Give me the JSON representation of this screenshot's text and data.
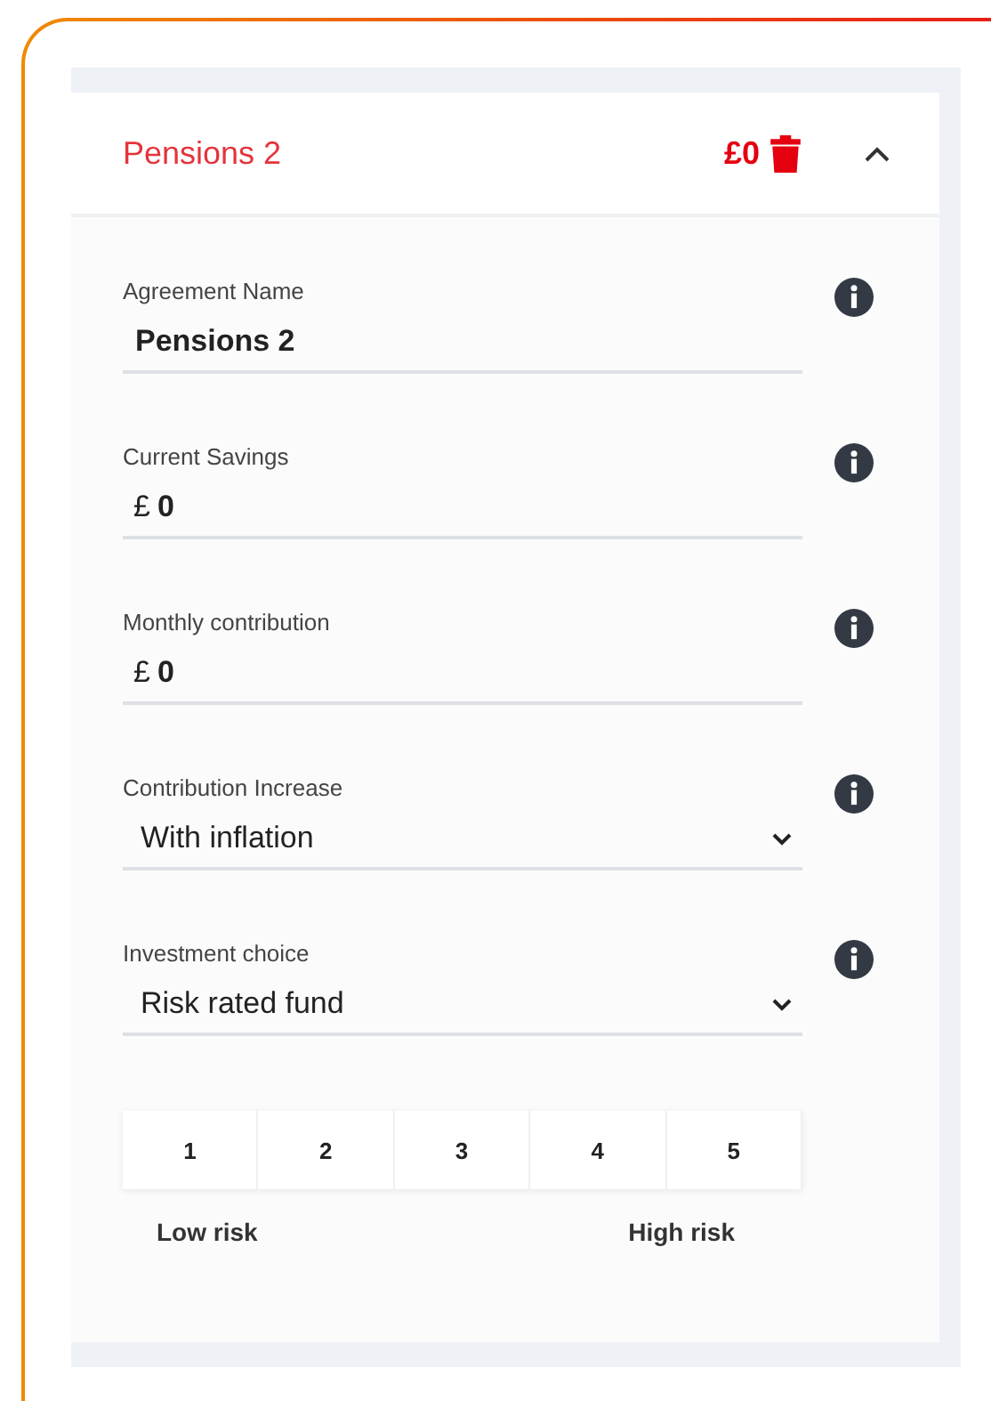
{
  "panel": {
    "title": "Pensions 2",
    "amount": "£0",
    "expanded": true
  },
  "fields": [
    {
      "kind": "text",
      "label": "Agreement Name",
      "value": "Pensions 2"
    },
    {
      "kind": "money",
      "label": "Current Savings",
      "currency": "£",
      "value": "0"
    },
    {
      "kind": "money",
      "label": "Monthly contribution",
      "currency": "£",
      "value": "0"
    },
    {
      "kind": "select",
      "label": "Contribution Increase",
      "value": "With inflation"
    },
    {
      "kind": "select",
      "label": "Investment choice",
      "value": "Risk rated fund"
    }
  ],
  "risk_levels": [
    "1",
    "2",
    "3",
    "4",
    "5"
  ],
  "risk_labels": {
    "low": "Low risk",
    "high": "High risk"
  }
}
